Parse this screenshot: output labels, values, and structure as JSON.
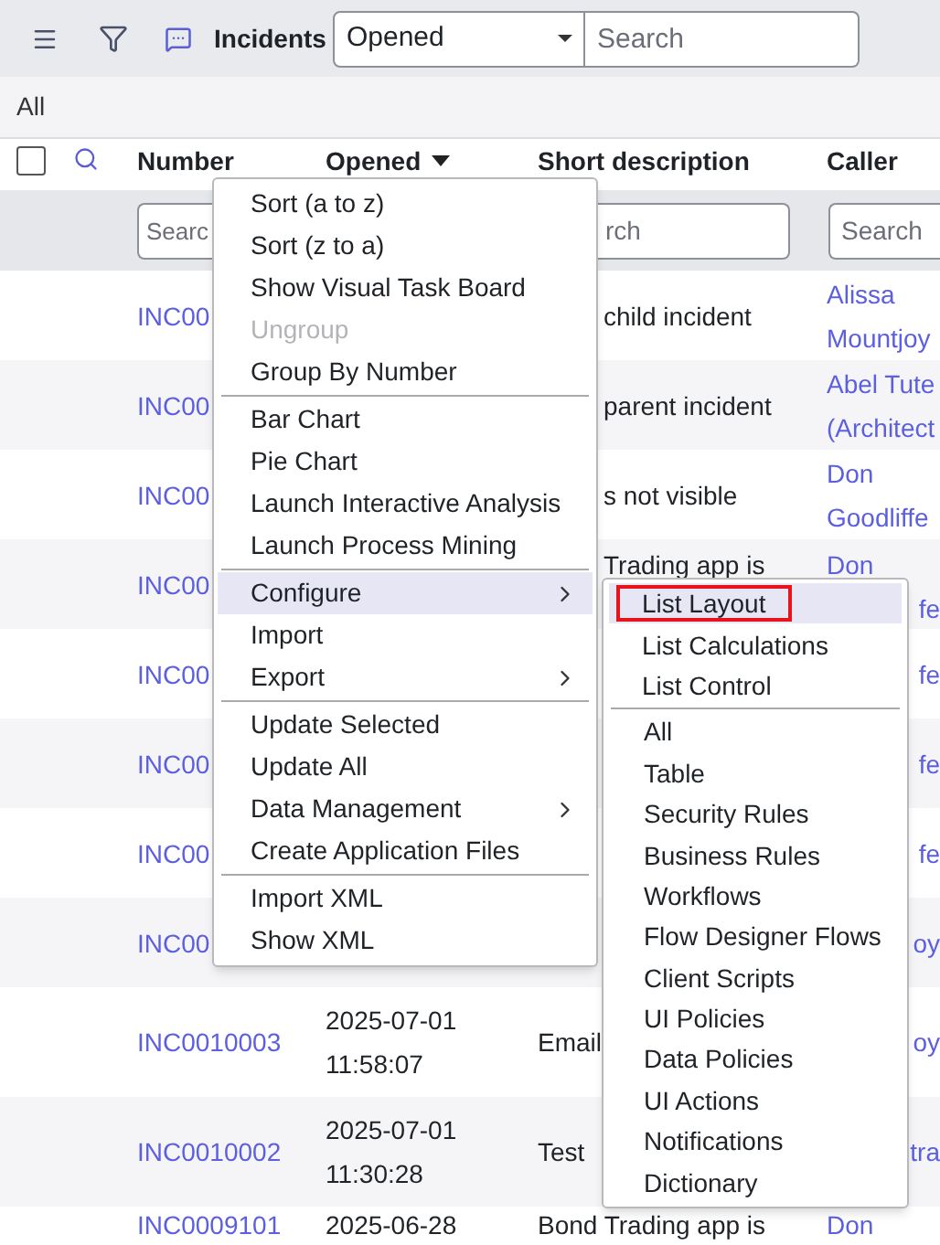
{
  "toolbar": {
    "title": "Incidents",
    "filter_select": {
      "value": "Opened"
    },
    "search": {
      "placeholder": "Search"
    }
  },
  "breadcrumb": "All",
  "table": {
    "select_all": {
      "checked": false
    },
    "columns": [
      {
        "label": "Number",
        "sorted": false
      },
      {
        "label": "Opened",
        "sorted": true
      },
      {
        "label": "Short description",
        "sorted": false
      },
      {
        "label": "Caller",
        "sorted": false
      }
    ],
    "filters": [
      {
        "placeholder": "Searc"
      },
      {
        "placeholder": "rch"
      },
      {
        "placeholder": "Search"
      }
    ],
    "rows": [
      {
        "number": "INC00",
        "opened": [],
        "description": [
          "child incident"
        ],
        "caller": [
          "Alissa",
          "Mountjoy"
        ],
        "kind": "covered"
      },
      {
        "number": "INC00",
        "opened": [],
        "description": [
          "parent incident"
        ],
        "caller": [
          "Abel Tute",
          "(Architect"
        ],
        "kind": "covered"
      },
      {
        "number": "INC00",
        "opened": [],
        "description": [
          "s not visible"
        ],
        "caller": [
          "Don",
          "Goodliffe"
        ],
        "kind": "covered"
      },
      {
        "number": "INC00",
        "opened": [],
        "description": [
          "Trading app is"
        ],
        "caller": [
          "Don",
          "fe"
        ],
        "kind": "covered"
      },
      {
        "number": "INC00",
        "opened": [],
        "description": [],
        "caller": [
          "fe"
        ],
        "kind": "covered"
      },
      {
        "number": "INC00",
        "opened": [],
        "description": [],
        "caller": [
          "fe"
        ],
        "kind": "covered"
      },
      {
        "number": "INC00",
        "opened": [],
        "description": [],
        "caller": [
          "fe"
        ],
        "kind": "covered"
      },
      {
        "number": "INC00",
        "opened": [],
        "description": [],
        "caller": [
          "oy"
        ],
        "kind": "covered"
      },
      {
        "number": "INC0010003",
        "opened": [
          "2025-07-01",
          "11:58:07"
        ],
        "description": [
          "Email"
        ],
        "caller": [
          "oy"
        ],
        "kind": "open"
      },
      {
        "number": "INC0010002",
        "opened": [
          "2025-07-01",
          "11:30:28"
        ],
        "description": [
          "Test"
        ],
        "caller": [
          "tra"
        ],
        "kind": "open"
      },
      {
        "number": "INC0009101",
        "opened": [
          "2025-06-28"
        ],
        "description": [
          "Bond Trading app is"
        ],
        "caller": [
          "Don"
        ],
        "kind": "open"
      }
    ]
  },
  "context_menu": {
    "groups": [
      [
        {
          "label": "Sort (a to z)",
          "disabled": false,
          "submenu": false,
          "selected": false
        },
        {
          "label": "Sort (z to a)",
          "disabled": false,
          "submenu": false,
          "selected": false
        },
        {
          "label": "Show Visual Task Board",
          "disabled": false,
          "submenu": false,
          "selected": false
        },
        {
          "label": "Ungroup",
          "disabled": true,
          "submenu": false,
          "selected": false
        },
        {
          "label": "Group By Number",
          "disabled": false,
          "submenu": false,
          "selected": false
        }
      ],
      [
        {
          "label": "Bar Chart",
          "disabled": false,
          "submenu": false,
          "selected": false
        },
        {
          "label": "Pie Chart",
          "disabled": false,
          "submenu": false,
          "selected": false
        },
        {
          "label": "Launch Interactive Analysis",
          "disabled": false,
          "submenu": false,
          "selected": false
        },
        {
          "label": "Launch Process Mining",
          "disabled": false,
          "submenu": false,
          "selected": false
        }
      ],
      [
        {
          "label": "Configure",
          "disabled": false,
          "submenu": true,
          "selected": true
        },
        {
          "label": "Import",
          "disabled": false,
          "submenu": false,
          "selected": false
        },
        {
          "label": "Export",
          "disabled": false,
          "submenu": true,
          "selected": false
        }
      ],
      [
        {
          "label": "Update Selected",
          "disabled": false,
          "submenu": false,
          "selected": false
        },
        {
          "label": "Update All",
          "disabled": false,
          "submenu": false,
          "selected": false
        },
        {
          "label": "Data Management",
          "disabled": false,
          "submenu": true,
          "selected": false
        },
        {
          "label": "Create Application Files",
          "disabled": false,
          "submenu": false,
          "selected": false
        }
      ],
      [
        {
          "label": "Import XML",
          "disabled": false,
          "submenu": false,
          "selected": false
        },
        {
          "label": "Show XML",
          "disabled": false,
          "submenu": false,
          "selected": false
        }
      ]
    ]
  },
  "submenu": {
    "groups": [
      [
        {
          "label": "List Layout",
          "selected": true,
          "marked": true
        },
        {
          "label": "List Calculations",
          "selected": false,
          "marked": false
        },
        {
          "label": "List Control",
          "selected": false,
          "marked": false
        }
      ],
      [
        {
          "label": "All",
          "selected": false,
          "marked": false
        },
        {
          "label": "Table",
          "selected": false,
          "marked": false
        },
        {
          "label": "Security Rules",
          "selected": false,
          "marked": false
        },
        {
          "label": "Business Rules",
          "selected": false,
          "marked": false
        },
        {
          "label": "Workflows",
          "selected": false,
          "marked": false
        },
        {
          "label": "Flow Designer Flows",
          "selected": false,
          "marked": false
        },
        {
          "label": "Client Scripts",
          "selected": false,
          "marked": false
        },
        {
          "label": "UI Policies",
          "selected": false,
          "marked": false
        },
        {
          "label": "Data Policies",
          "selected": false,
          "marked": false
        },
        {
          "label": "UI Actions",
          "selected": false,
          "marked": false
        },
        {
          "label": "Notifications",
          "selected": false,
          "marked": false
        },
        {
          "label": "Dictionary",
          "selected": false,
          "marked": false
        }
      ]
    ]
  }
}
